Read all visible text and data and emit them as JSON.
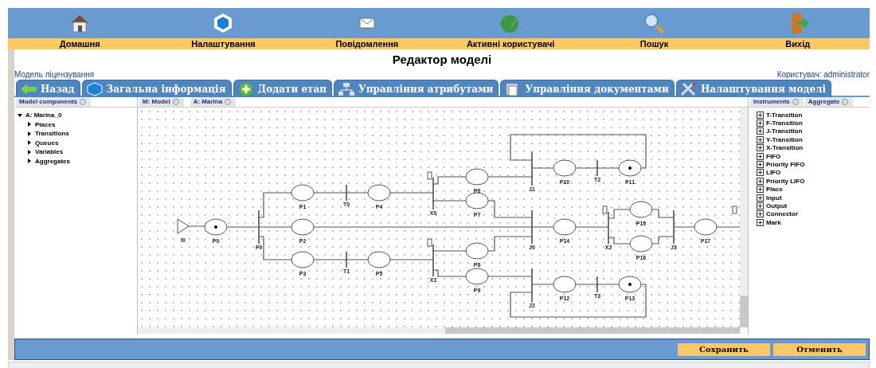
{
  "nav": [
    {
      "kind": "home",
      "label": "Домашня"
    },
    {
      "kind": "settings",
      "label": "Налаштування"
    },
    {
      "kind": "mail",
      "label": "Повідомлення"
    },
    {
      "kind": "users",
      "label": "Активні користувачі"
    },
    {
      "kind": "search",
      "label": "Пошук"
    },
    {
      "kind": "exit",
      "label": "Вихід"
    }
  ],
  "page_title": "Редактор моделі",
  "breadcrumb": "Модель ліцензування",
  "user": "Користувач: administrator",
  "tabs": [
    {
      "kind": "back",
      "label": "Назад"
    },
    {
      "kind": "info",
      "label": "Загальна інформація"
    },
    {
      "kind": "add",
      "label": "Додати етап"
    },
    {
      "kind": "attrs",
      "label": "Управління атрибутами"
    },
    {
      "kind": "docs",
      "label": "Управління документами"
    },
    {
      "kind": "tools",
      "label": "Налаштування моделі"
    }
  ],
  "left_panel": {
    "tabs": [
      "Model components"
    ],
    "tree": [
      {
        "label": "A: Marina_0",
        "expanded": true,
        "children": [
          {
            "label": "Places",
            "expanded": false
          },
          {
            "label": "Transitions",
            "expanded": false
          },
          {
            "label": "Queues",
            "expanded": false
          },
          {
            "label": "Variables",
            "expanded": false
          },
          {
            "label": "Aggregates",
            "expanded": false
          }
        ]
      }
    ]
  },
  "canvas": {
    "tabs": [
      "M: Model",
      "A: Marina"
    ],
    "nodes": [
      {
        "kind": "input",
        "label": "I0"
      },
      {
        "kind": "place",
        "label": "P0",
        "marked": true
      },
      {
        "kind": "transition",
        "label": "F0"
      },
      {
        "kind": "place",
        "label": "P1",
        "marked": false
      },
      {
        "kind": "place",
        "label": "P2",
        "marked": false
      },
      {
        "kind": "place",
        "label": "P3",
        "marked": false
      },
      {
        "kind": "transition",
        "label": "T0"
      },
      {
        "kind": "transition",
        "label": "T1"
      },
      {
        "kind": "place",
        "label": "P4",
        "marked": false
      },
      {
        "kind": "place",
        "label": "P5",
        "marked": false
      },
      {
        "kind": "queue_transition",
        "label": "X0"
      },
      {
        "kind": "queue_transition",
        "label": "X1"
      },
      {
        "kind": "place",
        "label": "P6",
        "marked": false
      },
      {
        "kind": "place",
        "label": "P7",
        "marked": false
      },
      {
        "kind": "place",
        "label": "P8",
        "marked": false
      },
      {
        "kind": "place",
        "label": "P9",
        "marked": false
      },
      {
        "kind": "transition",
        "label": "J1"
      },
      {
        "kind": "transition",
        "label": "J0"
      },
      {
        "kind": "transition",
        "label": "J2"
      },
      {
        "kind": "place",
        "label": "P10",
        "marked": false
      },
      {
        "kind": "transition",
        "label": "T2"
      },
      {
        "kind": "place",
        "label": "P11",
        "marked": true
      },
      {
        "kind": "place",
        "label": "P14",
        "marked": false
      },
      {
        "kind": "queue_transition",
        "label": "X2"
      },
      {
        "kind": "place",
        "label": "P15",
        "marked": false
      },
      {
        "kind": "place",
        "label": "P16",
        "marked": false
      },
      {
        "kind": "transition",
        "label": "J3"
      },
      {
        "kind": "place",
        "label": "P17",
        "marked": false
      },
      {
        "kind": "place",
        "label": "P12",
        "marked": false
      },
      {
        "kind": "transition",
        "label": "T3"
      },
      {
        "kind": "place",
        "label": "P13",
        "marked": true
      }
    ]
  },
  "right_panel": {
    "tabs": [
      "Instruments",
      "Aggregate"
    ],
    "tools": [
      "T-Transition",
      "F-Transition",
      "J-Transition",
      "Y-Transition",
      "X-Transition",
      "FIFO",
      "Priority FIFO",
      "LIFO",
      "Priority LIFO",
      "Place",
      "Input",
      "Output",
      "Connector",
      "Mark"
    ]
  },
  "buttons": [
    "Сохранить",
    "Отменить"
  ]
}
